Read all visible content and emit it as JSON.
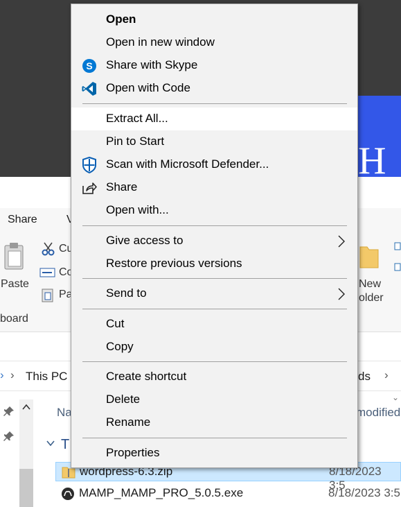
{
  "ribbon": {
    "tab_share": "Share",
    "tab_view_fragment": "V",
    "paste_label": "Paste",
    "cut_fragment": "Cu",
    "copy_fragment": "Co",
    "paste_shortcut_fragment": "Pa",
    "group_clipboard_fragment": "board",
    "new_folder_line1": "New",
    "new_folder_line2": "older"
  },
  "address": {
    "this_pc": "This PC",
    "downloads_fragment": "ds"
  },
  "columns": {
    "name_fragment": "Na",
    "date_modified_fragment": "modified"
  },
  "group_header_fragment": "T",
  "files": [
    {
      "name": "wordpress-6.3.zip",
      "date": "8/18/2023 3:5"
    },
    {
      "name": "MAMP_MAMP_PRO_5.0.5.exe",
      "date": "8/18/2023 3:5"
    }
  ],
  "context_menu": {
    "items": [
      {
        "label": "Open",
        "icon": null
      },
      {
        "label": "Open in new window",
        "icon": null
      },
      {
        "label": "Share with Skype",
        "icon": "skype-icon"
      },
      {
        "label": "Open with Code",
        "icon": "vscode-icon"
      },
      {
        "label": "Extract All...",
        "icon": null
      },
      {
        "label": "Pin to Start",
        "icon": null
      },
      {
        "label": "Scan with Microsoft Defender...",
        "icon": "defender-shield-icon"
      },
      {
        "label": "Share",
        "icon": "share-icon"
      },
      {
        "label": "Open with...",
        "icon": null
      },
      {
        "label": "Give access to",
        "icon": null,
        "submenu": true
      },
      {
        "label": "Restore previous versions",
        "icon": null
      },
      {
        "label": "Send to",
        "icon": null,
        "submenu": true
      },
      {
        "label": "Cut",
        "icon": null
      },
      {
        "label": "Copy",
        "icon": null
      },
      {
        "label": "Create shortcut",
        "icon": null
      },
      {
        "label": "Delete",
        "icon": null
      },
      {
        "label": "Rename",
        "icon": null
      },
      {
        "label": "Properties",
        "icon": null
      }
    ],
    "highlighted_item": "Extract All..."
  },
  "colors": {
    "menu_background": "#f2f2f2",
    "menu_highlight": "#ffffff",
    "skype_blue": "#0078d4",
    "vscode_blue": "#0065a9",
    "defender_blue": "#0a5fb4",
    "banner_blue": "#3357e8",
    "selection_blue": "#cce8ff"
  }
}
